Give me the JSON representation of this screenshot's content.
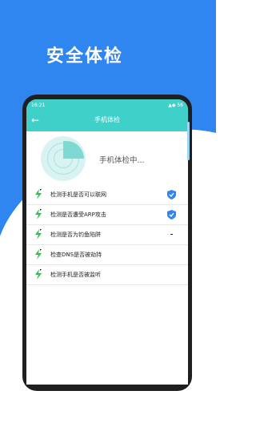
{
  "hero": {
    "title": "安全体检"
  },
  "status_bar": {
    "time": "16:21",
    "right": "▲◆ 56"
  },
  "app": {
    "back_icon": "back-arrow-icon",
    "title": "手机体检"
  },
  "scan": {
    "text": "手机体检中..."
  },
  "checks": [
    {
      "label": "检测手机是否可以联网",
      "status": "shield-check"
    },
    {
      "label": "检测是否遭受ARP攻击",
      "status": "shield-check"
    },
    {
      "label": "检测是否为钓鱼陷阱",
      "status": "dash"
    },
    {
      "label": "检查DNS是否被劫持",
      "status": ""
    },
    {
      "label": "检测手机是否被监听",
      "status": ""
    }
  ],
  "colors": {
    "brand_blue": "#2f86f0",
    "teal": "#3fd0c9",
    "bolt_green": "#2fbf4a",
    "shield_blue": "#2f86f0"
  }
}
